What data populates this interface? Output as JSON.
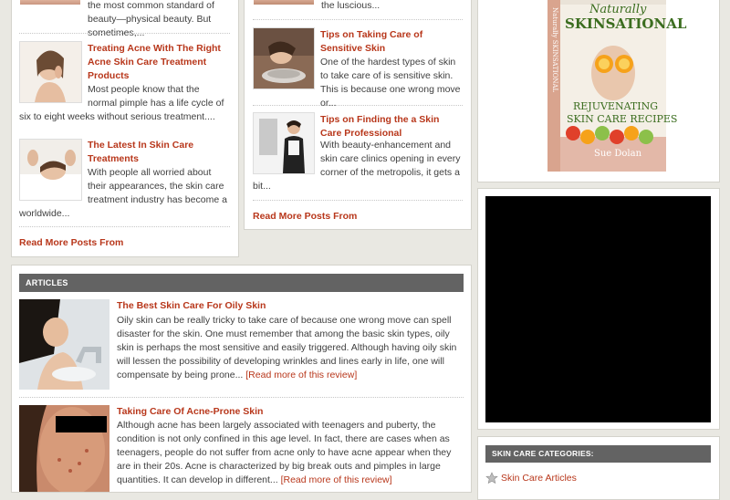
{
  "left_column_posts": {
    "top_fragment": "the most common standard of beauty—physical beauty. But sometimes,...",
    "post1": {
      "title": "Treating Acne With The Right Acne Skin Care Treatment Products",
      "excerpt": "Most people know that the normal pimple has a life cycle of six to eight weeks without serious treatment...."
    },
    "post2": {
      "title": "The Latest In Skin Care Treatments",
      "excerpt": "With people all worried about their appearances, the skin care treatment industry has become a worldwide..."
    },
    "read_more": "Read More Posts From"
  },
  "middle_column_posts": {
    "top_fragment": "the luscious...",
    "post1": {
      "title": "Tips on Taking Care of Sensitive Skin",
      "excerpt": "One of the hardest types of skin to take care of is sensitive skin. This is because one wrong move or..."
    },
    "post2": {
      "title": "Tips on Finding the a Skin Care Professional",
      "excerpt": "With beauty-enhancement and skin care clinics opening in every corner of the metropolis, it gets a bit..."
    },
    "read_more": "Read More Posts From"
  },
  "articles": {
    "heading": "ARTICLES",
    "items": [
      {
        "title": "The Best Skin Care For Oily Skin",
        "excerpt": "Oily skin can be really tricky to take care of because one wrong move can spell disaster for the skin. One must remember that among the basic skin types, oily skin is perhaps the most sensitive and easily triggered. Although having oily skin will lessen the possibility of developing wrinkles and lines early in life, one will compensate by being prone...",
        "more": "[Read more of this review]"
      },
      {
        "title": "Taking Care Of Acne-Prone Skin",
        "excerpt": "Although acne has been largely associated with teenagers and puberty, the condition is not only confined in this age level. In fact, there are cases when as teenagers, people do not suffer from acne only to have acne appear when they are in their 20s. Acne is characterized by big break outs and pimples in large quantities. It can develop in different...",
        "more": "[Read more of this review]"
      }
    ]
  },
  "sidebar": {
    "book": {
      "title_line1": "Naturally",
      "title_line2": "SKINSATIONAL",
      "subtitle1": "REJUVENATING",
      "subtitle2": "SKIN CARE RECIPES",
      "author": "Sue Dolan",
      "spine": "Naturally SKINSATIONAL"
    },
    "categories": {
      "heading": "SKIN CARE CATEGORIES:",
      "items": [
        "Skin Care Articles"
      ]
    }
  },
  "colors": {
    "accent": "#b8371b",
    "section_bar": "#636363",
    "page_bg": "#e9e8e2"
  }
}
